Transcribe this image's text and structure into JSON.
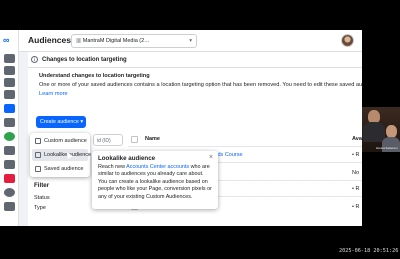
{
  "app": {
    "logo": "∞"
  },
  "header": {
    "title": "Audiences",
    "account_label": "MantraM Digital Media (2…",
    "account_icon": "ad-account-icon",
    "avatar": "user-avatar"
  },
  "notice": {
    "banner_title": "Changes to location targeting",
    "heading": "Understand changes to location targeting",
    "body": "One or more of your saved audiences contains a location targeting option that has been removed. You need to edit these saved audiences befo",
    "learn_more": "Learn more"
  },
  "toolbar": {
    "create_button": "Create audience ▾",
    "search_placeholder": "id (ID)"
  },
  "create_menu": {
    "items": [
      {
        "label": "Custom audience"
      },
      {
        "label": "Lookalike audience"
      },
      {
        "label": "Saved audience"
      }
    ]
  },
  "table": {
    "col_name": "Name",
    "col_availability": "Ava",
    "rows": [
      {
        "name_tail": "ta Ads Course",
        "availability": "• R"
      },
      {
        "name_tail": "",
        "availability": "No"
      },
      {
        "name_tail": "",
        "availability": "• R"
      },
      {
        "name_tail": "",
        "availability": "• R"
      }
    ]
  },
  "filter": {
    "title": "Filter",
    "items": [
      {
        "label": "Status"
      },
      {
        "label": "Type"
      }
    ]
  },
  "tooltip": {
    "title": "Lookalike audience",
    "close": "×",
    "body_pre": "Reach new ",
    "body_link": "Accounts Center accounts",
    "body_post": " who are similar to audiences you already care about. You can create a lookalike audience based on people who like your Page, conversion pixels or any of your existing Custom Audiences."
  },
  "webcam": {
    "tag": "Hanna Kelemen"
  },
  "recording_timestamp": "2025-06-18 20:51:26"
}
